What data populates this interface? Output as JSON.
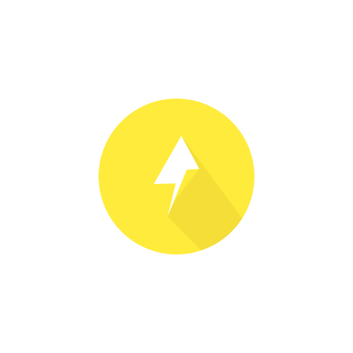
{
  "icon": {
    "name": "lightning-bolt-icon",
    "background_color": "#ffeb3b",
    "shadow_color": "#f2dc37",
    "glyph_color": "#ffffff"
  }
}
